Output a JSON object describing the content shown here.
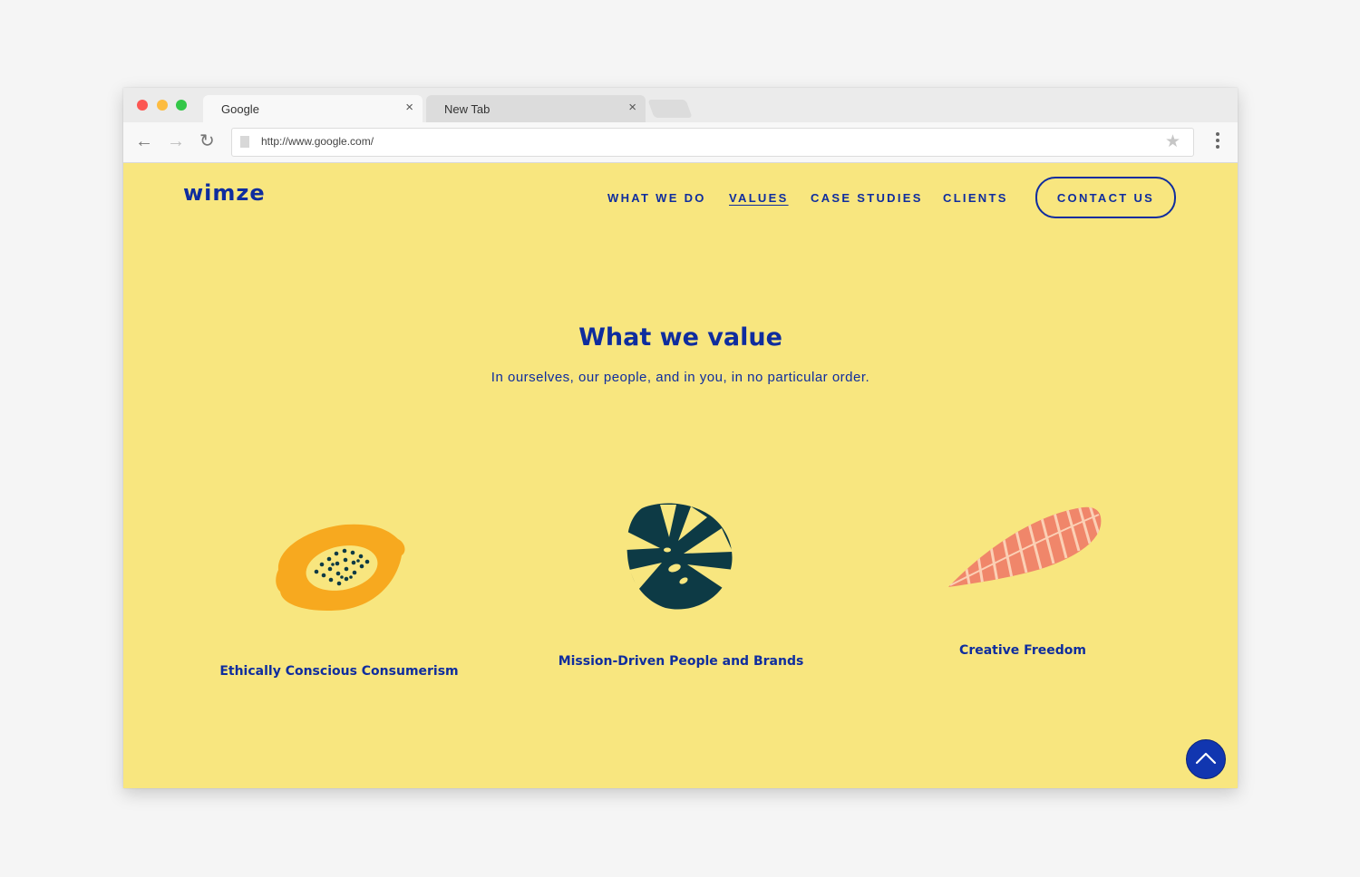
{
  "browser": {
    "tabs": [
      {
        "title": "Google",
        "close": "×"
      },
      {
        "title": "New Tab",
        "close": "×"
      }
    ],
    "url": "http://www.google.com/"
  },
  "site": {
    "logo": "wimze",
    "nav": [
      "WHAT WE DO",
      "VALUES",
      "CASE STUDIES",
      "CLIENTS"
    ],
    "active_nav": "VALUES",
    "cta": "CONTACT US",
    "heading": "What we value",
    "subheading": "In ourselves, our people, and in you, in no particular order.",
    "values": [
      {
        "label": "Ethically Conscious Consumerism",
        "icon": "papaya-icon"
      },
      {
        "label": "Mission-Driven People and Brands",
        "icon": "monstera-leaf-icon"
      },
      {
        "label": "Creative Freedom",
        "icon": "feather-leaf-icon"
      }
    ]
  },
  "colors": {
    "page_bg": "#f8e67f",
    "brand_blue": "#0f2d9e",
    "papaya_orange": "#f7a91f",
    "leaf_dark": "#0d3a45",
    "feather_coral": "#f0866a"
  }
}
